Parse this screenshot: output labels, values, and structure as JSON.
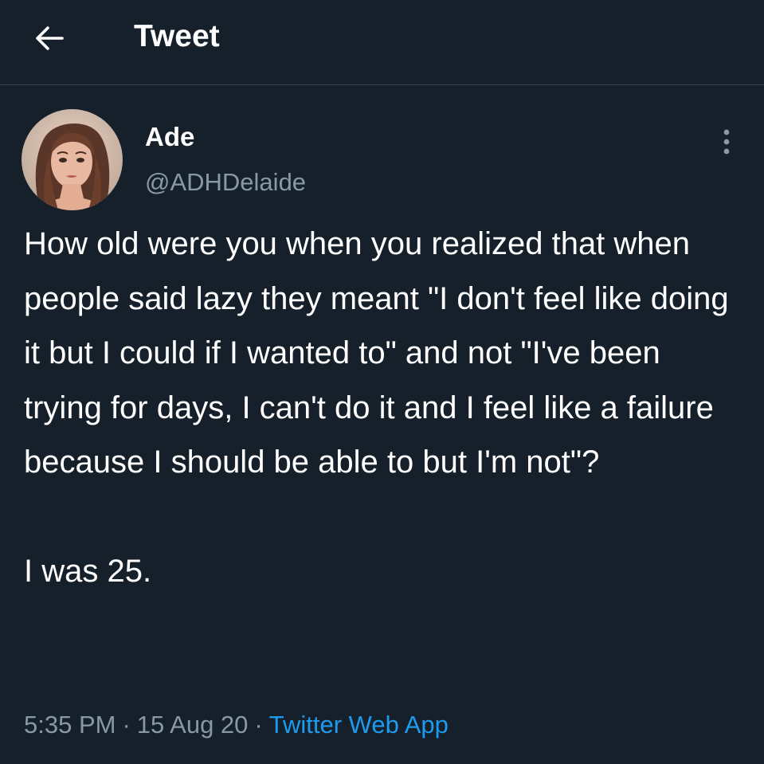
{
  "header": {
    "back_icon": "arrow-left-icon",
    "title": "Tweet"
  },
  "tweet": {
    "author": {
      "name": "Ade",
      "handle": "@ADHDelaide",
      "avatar": "profile-photo"
    },
    "more_icon": "more-vertical-icon",
    "paragraphs": [
      "How old were you when you realized that when people said lazy they meant \"I don't feel like doing it but I could if I wanted to\" and not \"I've been trying for days, I can't do it and I feel like a failure because I should be able to but I'm not\"?",
      "I was 25."
    ],
    "time": "5:35 PM",
    "date": "15 Aug 20",
    "source": "Twitter Web App",
    "separator": "·"
  },
  "colors": {
    "background": "#15202b",
    "divider": "#38444d",
    "text": "#ffffff",
    "muted": "#8899a6",
    "link": "#1d9bf0"
  }
}
